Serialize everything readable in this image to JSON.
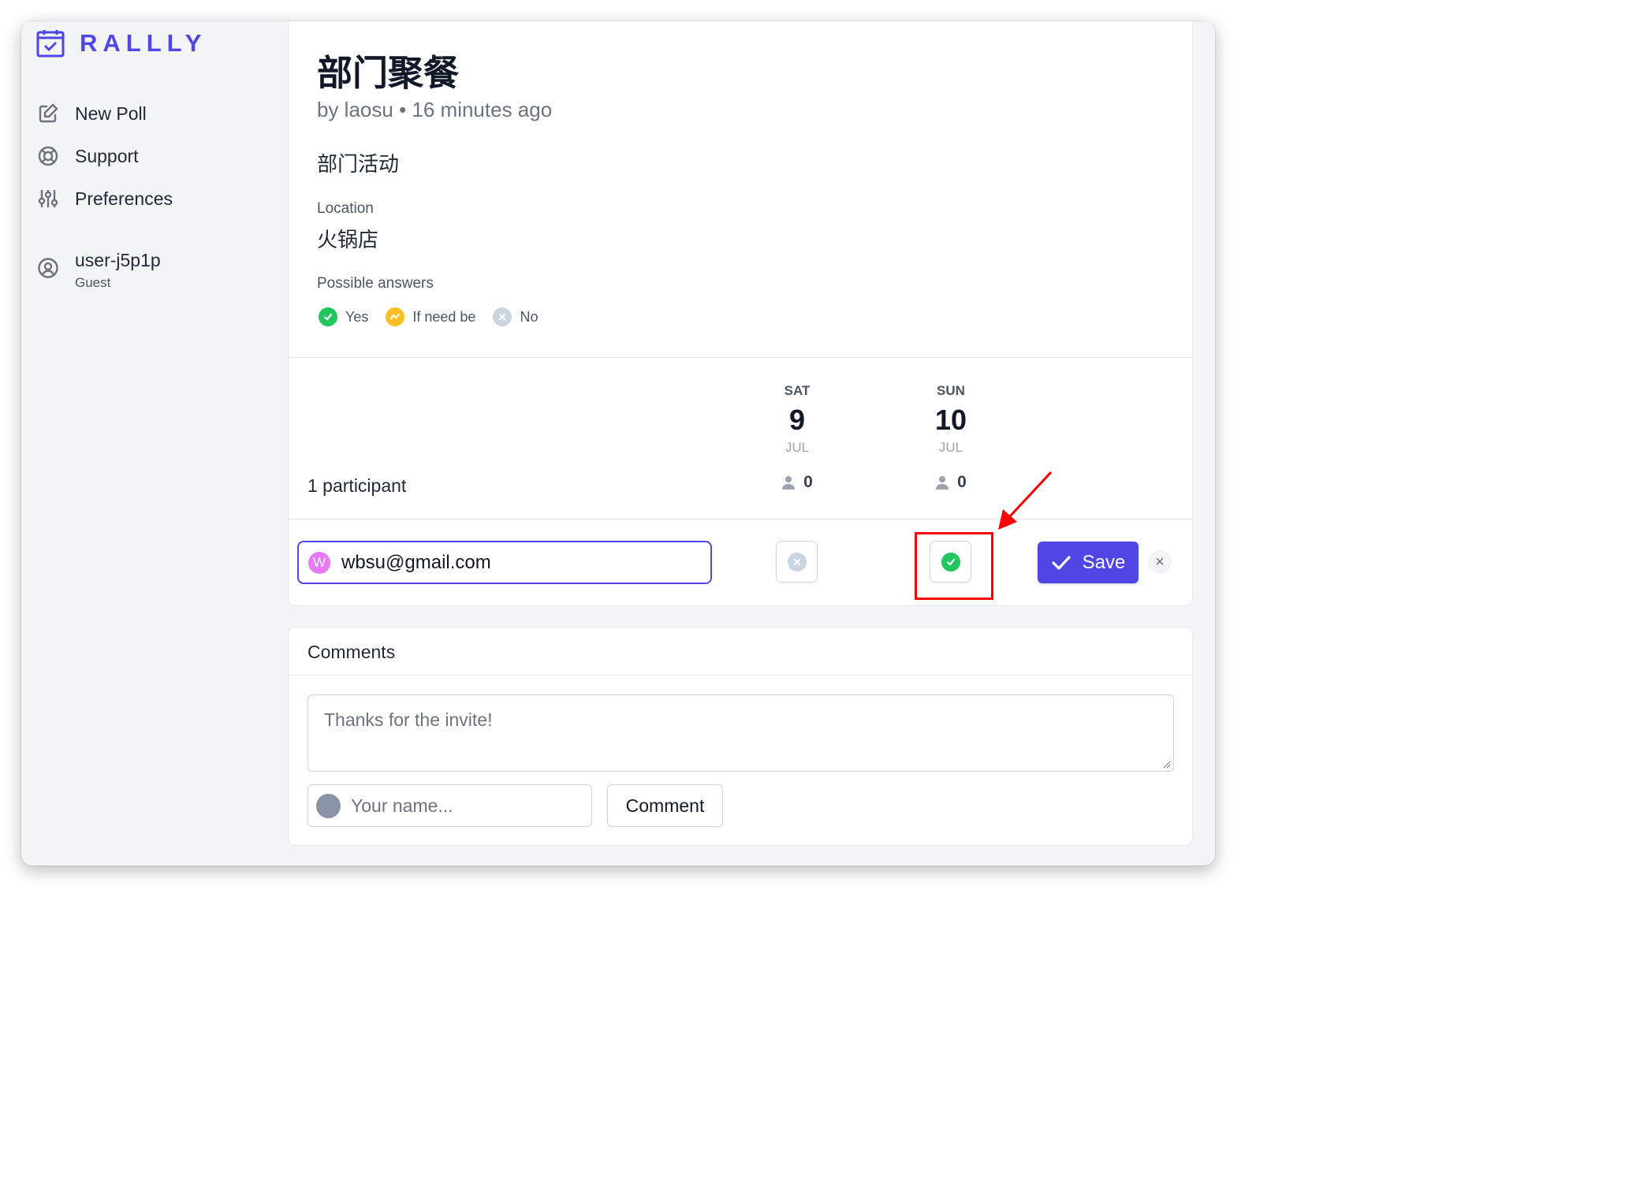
{
  "brand": {
    "name": "RALLLY",
    "accent": "#4f46e5"
  },
  "sidebar": {
    "items": [
      {
        "label": "New Poll",
        "icon": "pencil-square-icon"
      },
      {
        "label": "Support",
        "icon": "lifebuoy-icon"
      },
      {
        "label": "Preferences",
        "icon": "sliders-icon"
      }
    ],
    "user": {
      "name": "user-j5p1p",
      "role": "Guest",
      "icon": "user-circle-icon"
    }
  },
  "poll": {
    "title": "部门聚餐",
    "byline": "by laosu • 16 minutes ago",
    "description": "部门活动",
    "location_label": "Location",
    "location": "火锅店",
    "answers_label": "Possible answers",
    "answers": [
      {
        "label": "Yes",
        "color": "#22c55e"
      },
      {
        "label": "If need be",
        "color": "#fbbf24"
      },
      {
        "label": "No",
        "color": "#cbd5e1"
      }
    ],
    "participants_label": "1 participant",
    "options": [
      {
        "dow": "SAT",
        "day": "9",
        "month": "JUL",
        "count": "0"
      },
      {
        "dow": "SUN",
        "day": "10",
        "month": "JUL",
        "count": "0"
      }
    ],
    "entry": {
      "avatar_letter": "W",
      "name": "wbsu@gmail.com",
      "votes": [
        "no",
        "yes"
      ],
      "save_label": "Save",
      "close_label": "×"
    }
  },
  "comments": {
    "title": "Comments",
    "placeholder": "Thanks for the invite!",
    "name_placeholder": "Your name...",
    "button_label": "Comment"
  }
}
